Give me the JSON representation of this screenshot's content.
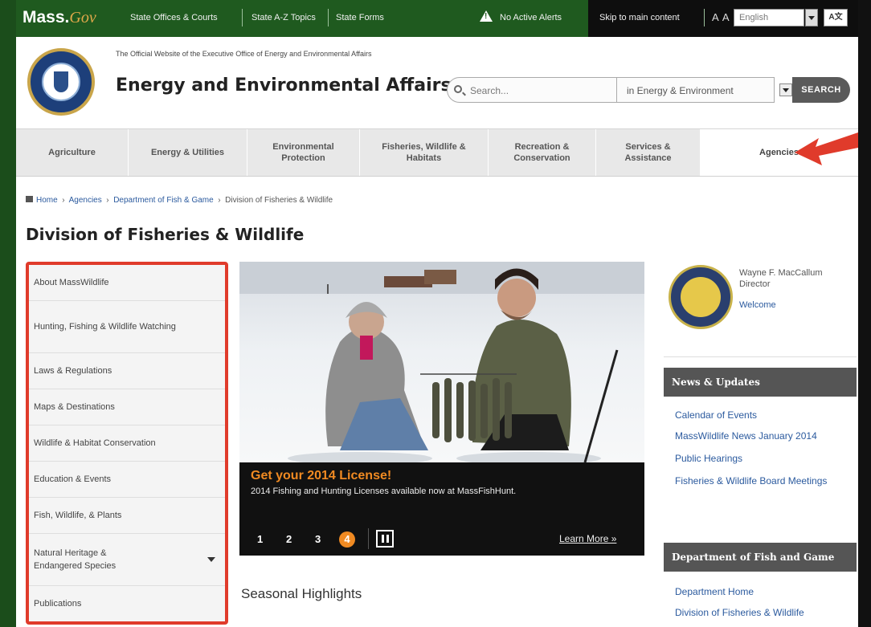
{
  "topbar": {
    "logo_main": "Mass.",
    "logo_gov": "Gov",
    "links": [
      "State Offices & Courts",
      "State A-Z Topics",
      "State Forms"
    ],
    "alert": "No Active Alerts",
    "skip": "Skip to main content",
    "text_size": "A A",
    "language": "English",
    "translate_label": "A文"
  },
  "header": {
    "official": "The Official Website of the Executive Office of Energy and Environmental Affairs",
    "title": "Energy and Environmental Affairs",
    "search_placeholder": "Search...",
    "search_scope": "in Energy & Environment",
    "search_button": "SEARCH"
  },
  "nav": {
    "items": [
      "Agriculture",
      "Energy & Utilities",
      "Environmental Protection",
      "Fisheries, Wildlife & Habitats",
      "Recreation & Conservation",
      "Services & Assistance",
      "Agencies"
    ]
  },
  "breadcrumb": [
    "Home",
    "Agencies",
    "Department of Fish & Game",
    "Division of Fisheries & Wildlife"
  ],
  "page_title": "Division of Fisheries & Wildlife",
  "sidebar": {
    "items": [
      "About MassWildlife",
      "Hunting, Fishing & Wildlife Watching",
      "Laws & Regulations",
      "Maps & Destinations",
      "Wildlife & Habitat Conservation",
      "Education & Events",
      "Fish, Wildlife, & Plants",
      "Natural Heritage & Endangered Species",
      "Publications"
    ]
  },
  "hero": {
    "title": "Get your 2014 License!",
    "subtitle": "2014 Fishing and Hunting Licenses available now at MassFishHunt.",
    "pages": [
      "1",
      "2",
      "3",
      "4"
    ],
    "active_page": "4",
    "learn_more": "Learn More »"
  },
  "seasonal": "Seasonal Highlights",
  "director": {
    "name": "Wayne F. MacCallum",
    "role": "Director",
    "welcome": "Welcome"
  },
  "news": {
    "heading": "News & Updates",
    "links": [
      "Calendar of Events",
      "MassWildlife News January 2014",
      "Public Hearings",
      "Fisheries & Wildlife Board Meetings"
    ]
  },
  "dfg": {
    "heading": "Department of Fish and Game",
    "links": [
      "Department Home",
      "Division of Fisheries & Wildlife"
    ]
  },
  "colors": {
    "gov_green": "#1f5a1f",
    "highlight_red": "#e03b2b",
    "accent_orange": "#f08a22",
    "link_blue": "#2b5a9e"
  }
}
